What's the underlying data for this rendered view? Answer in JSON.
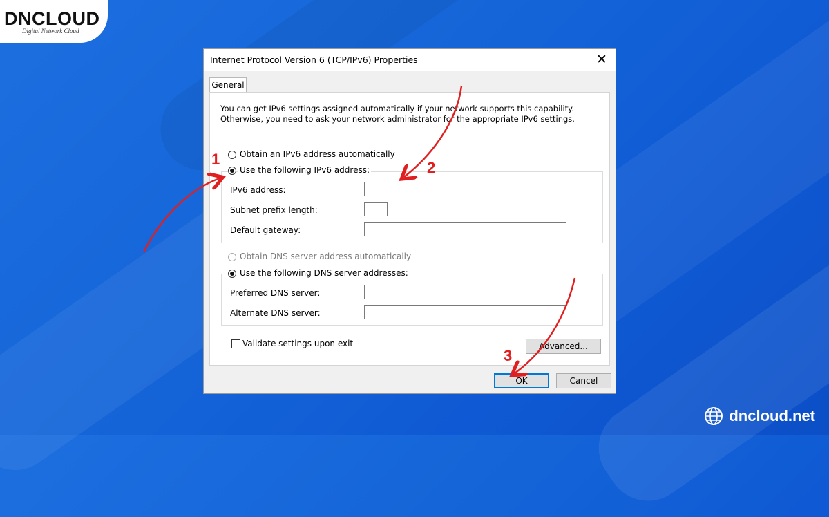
{
  "branding": {
    "logo_text": "DNCLOUD",
    "logo_tagline": "Digital Network Cloud",
    "site": "dncloud.net"
  },
  "dialog": {
    "title": "Internet Protocol Version 6 (TCP/IPv6) Properties",
    "tab": "General",
    "description": "You can get IPv6 settings assigned automatically if your network supports this capability.\nOtherwise, you need to ask your network administrator for the appropriate IPv6 settings.",
    "ip_section": {
      "auto_label": "Obtain an IPv6 address automatically",
      "auto_selected": false,
      "manual_label": "Use the following IPv6 address:",
      "manual_selected": true,
      "fields": [
        {
          "label": "IPv6 address:",
          "value": ""
        },
        {
          "label": "Subnet prefix length:",
          "value": ""
        },
        {
          "label": "Default gateway:",
          "value": ""
        }
      ]
    },
    "dns_section": {
      "auto_label": "Obtain DNS server address automatically",
      "auto_selected": false,
      "auto_disabled": true,
      "manual_label": "Use the following DNS server addresses:",
      "manual_selected": true,
      "fields": [
        {
          "label": "Preferred DNS server:",
          "value": ""
        },
        {
          "label": "Alternate DNS server:",
          "value": ""
        }
      ]
    },
    "validate_label": "Validate settings upon exit",
    "validate_checked": false,
    "advanced_label": "Advanced...",
    "ok_label": "OK",
    "cancel_label": "Cancel",
    "close_glyph": "✕"
  },
  "annotations": {
    "step1": "1",
    "step2": "2",
    "step3": "3",
    "color": "#e02020"
  },
  "colors": {
    "background": "#1565d8",
    "accent": "#0078d7"
  }
}
